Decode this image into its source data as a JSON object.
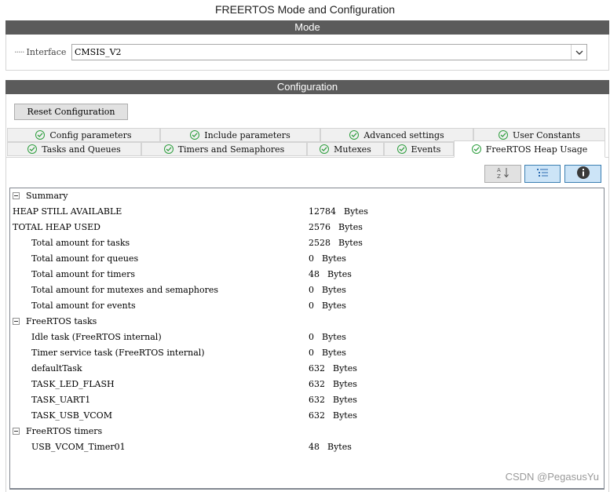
{
  "window": {
    "title": "FREERTOS Mode and Configuration"
  },
  "mode": {
    "section_title": "Mode",
    "interface_label": "Interface",
    "interface_value": "CMSIS_V2"
  },
  "configuration": {
    "section_title": "Configuration",
    "reset_label": "Reset Configuration",
    "tabs_row1": [
      "Config parameters",
      "Include parameters",
      "Advanced settings",
      "User Constants"
    ],
    "tabs_row2": [
      "Tasks and Queues",
      "Timers and Semaphores",
      "Mutexes",
      "Events",
      "FreeRTOS Heap Usage"
    ],
    "active_tab": "FreeRTOS Heap Usage",
    "toolbar": {
      "sort_icon": "sort-az-icon",
      "list_icon": "list-view-icon",
      "info_icon": "info-icon"
    }
  },
  "tree": {
    "rows": [
      {
        "kind": "group",
        "label": "Summary"
      },
      {
        "kind": "item",
        "indent": 0,
        "label": "HEAP STILL AVAILABLE",
        "value": "12784",
        "unit": "Bytes"
      },
      {
        "kind": "item",
        "indent": 0,
        "label": "TOTAL HEAP USED",
        "value": "2576",
        "unit": "Bytes"
      },
      {
        "kind": "item",
        "indent": 1,
        "label": "Total amount for tasks",
        "value": "2528",
        "unit": "Bytes"
      },
      {
        "kind": "item",
        "indent": 1,
        "label": "Total amount for queues",
        "value": "0",
        "unit": "Bytes"
      },
      {
        "kind": "item",
        "indent": 1,
        "label": "Total amount for timers",
        "value": "48",
        "unit": "Bytes"
      },
      {
        "kind": "item",
        "indent": 1,
        "label": "Total amount for mutexes and semaphores",
        "value": "0",
        "unit": "Bytes"
      },
      {
        "kind": "item",
        "indent": 1,
        "label": "Total amount for events",
        "value": "0",
        "unit": "Bytes"
      },
      {
        "kind": "group",
        "label": "FreeRTOS tasks"
      },
      {
        "kind": "item",
        "indent": 1,
        "label": "Idle task (FreeRTOS internal)",
        "value": "0",
        "unit": "Bytes"
      },
      {
        "kind": "item",
        "indent": 1,
        "label": "Timer service task (FreeRTOS internal)",
        "value": "0",
        "unit": "Bytes"
      },
      {
        "kind": "item",
        "indent": 1,
        "label": "defaultTask",
        "value": "632",
        "unit": "Bytes"
      },
      {
        "kind": "item",
        "indent": 1,
        "label": "TASK_LED_FLASH",
        "value": "632",
        "unit": "Bytes"
      },
      {
        "kind": "item",
        "indent": 1,
        "label": "TASK_UART1",
        "value": "632",
        "unit": "Bytes"
      },
      {
        "kind": "item",
        "indent": 1,
        "label": "TASK_USB_VCOM",
        "value": "632",
        "unit": "Bytes"
      },
      {
        "kind": "group",
        "label": "FreeRTOS timers"
      },
      {
        "kind": "item",
        "indent": 1,
        "label": "USB_VCOM_Timer01",
        "value": "48",
        "unit": "Bytes"
      }
    ]
  },
  "watermark": "CSDN @PegasusYu"
}
